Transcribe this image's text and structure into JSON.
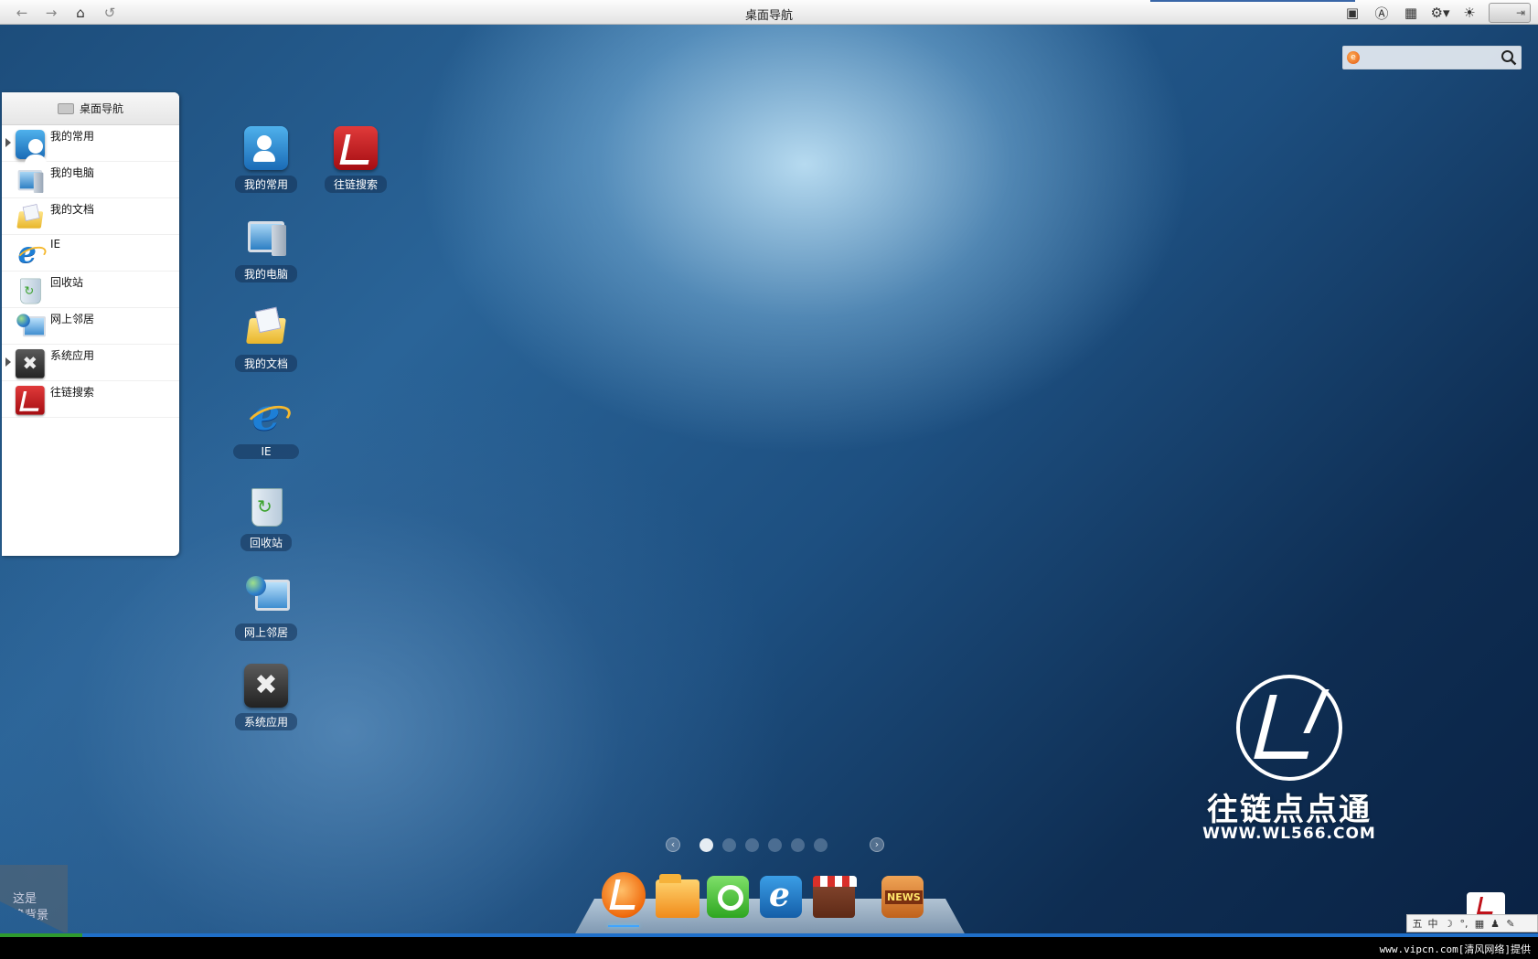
{
  "window": {
    "title": "桌面导航"
  },
  "toolbar": {
    "back": "←",
    "forward": "→",
    "home": "⌂",
    "refresh": "↺",
    "right_icons": [
      "briefcase-icon",
      "font-icon",
      "calculator-icon",
      "settings-icon",
      "brightness-icon"
    ],
    "right_glyphs": [
      "▣",
      "Ⓐ",
      "▦",
      "⚙▾",
      "☀"
    ],
    "exit": "⇥"
  },
  "search": {
    "placeholder": "",
    "logo": "e"
  },
  "nav_panel": {
    "title": "桌面导航",
    "items": [
      {
        "label": "我的常用",
        "icon": "user-icon",
        "expandable": true
      },
      {
        "label": "我的电脑",
        "icon": "computer-icon",
        "expandable": false
      },
      {
        "label": "我的文档",
        "icon": "documents-folder-icon",
        "expandable": false
      },
      {
        "label": "IE",
        "icon": "ie-icon",
        "expandable": false
      },
      {
        "label": "回收站",
        "icon": "recycle-bin-icon",
        "expandable": false
      },
      {
        "label": "网上邻居",
        "icon": "network-icon",
        "expandable": false
      },
      {
        "label": "系统应用",
        "icon": "system-tools-icon",
        "expandable": true
      },
      {
        "label": "往链搜索",
        "icon": "wl-search-icon",
        "expandable": false
      }
    ]
  },
  "desktop_icons": [
    {
      "label": "我的常用",
      "icon": "user-icon"
    },
    {
      "label": "往链搜索",
      "icon": "wl-search-icon"
    },
    {
      "label": "我的电脑",
      "icon": "computer-icon"
    },
    {
      "label": "我的文档",
      "icon": "documents-folder-icon"
    },
    {
      "label": "IE",
      "icon": "ie-icon"
    },
    {
      "label": "回收站",
      "icon": "recycle-bin-icon"
    },
    {
      "label": "网上邻居",
      "icon": "network-icon"
    },
    {
      "label": "系统应用",
      "icon": "system-tools-icon"
    }
  ],
  "pager": {
    "prev": "‹",
    "next": "›",
    "pages": 6,
    "active_page": 1
  },
  "dock": [
    {
      "icon": "wl-app-icon",
      "active": true
    },
    {
      "icon": "folder-icon",
      "active": false
    },
    {
      "icon": "search-app-icon",
      "active": false
    },
    {
      "icon": "ie-icon",
      "active": false
    },
    {
      "icon": "app-store-icon",
      "active": false
    },
    {
      "icon": "news-icon",
      "active": false
    }
  ],
  "tip_box": {
    "line1": "这是",
    "line2": "换背景"
  },
  "watermark": {
    "brand": "往链点点通",
    "url": "WWW.WL566.COM"
  },
  "ime": {
    "items": [
      "五",
      "中",
      "☽",
      "°,",
      "▦",
      "♟",
      "✎"
    ]
  },
  "credit": "www.vipcn.com[清风网络]提供",
  "colors": {
    "accent": "#1f6fc9",
    "brand_red": "#c0121a",
    "brand_orange": "#f06a0c"
  }
}
